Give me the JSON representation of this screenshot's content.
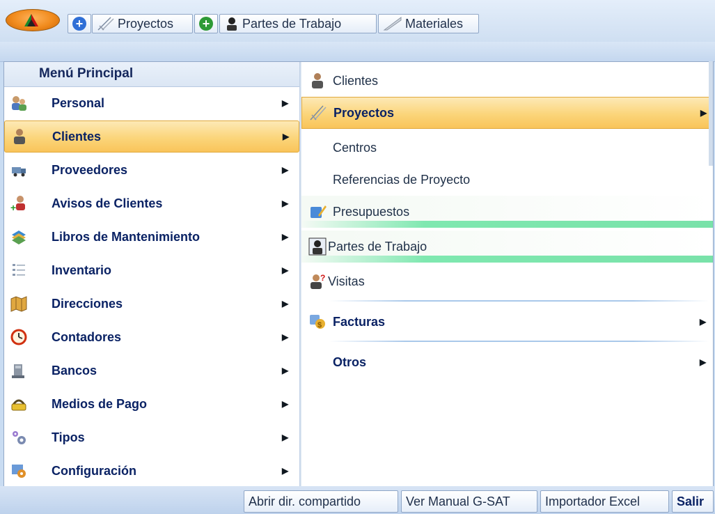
{
  "quick_access": {
    "items": [
      {
        "label": "Proyectos"
      },
      {
        "label": "Partes de Trabajo"
      },
      {
        "label": "Materiales"
      }
    ]
  },
  "menu": {
    "header": "Menú Principal",
    "left_items": [
      {
        "label": "Personal",
        "icon": "users-icon"
      },
      {
        "label": "Clientes",
        "icon": "client-icon"
      },
      {
        "label": "Proveedores",
        "icon": "truck-icon"
      },
      {
        "label": "Avisos de Clientes",
        "icon": "client-alert-icon"
      },
      {
        "label": "Libros de Mantenimiento",
        "icon": "books-icon"
      },
      {
        "label": "Inventario",
        "icon": "list-icon"
      },
      {
        "label": "Direcciones",
        "icon": "map-icon"
      },
      {
        "label": "Contadores",
        "icon": "clock-icon"
      },
      {
        "label": "Bancos",
        "icon": "bank-icon"
      },
      {
        "label": "Medios de Pago",
        "icon": "payment-icon"
      },
      {
        "label": "Tipos",
        "icon": "gears-icon"
      },
      {
        "label": "Configuración",
        "icon": "config-icon"
      }
    ],
    "right_items": [
      {
        "label": "Clientes",
        "icon": "client-icon"
      },
      {
        "label": "Proyectos",
        "icon": "project-icon"
      },
      {
        "label": "Centros"
      },
      {
        "label": "Referencias de Proyecto"
      },
      {
        "label": "Presupuestos",
        "icon": "budget-icon"
      },
      {
        "label": "Partes de Trabajo",
        "icon": "worker-icon"
      },
      {
        "label": "Visitas",
        "icon": "visit-icon"
      },
      {
        "label": "Facturas",
        "icon": "invoice-icon"
      },
      {
        "label": "Otros"
      }
    ]
  },
  "bottom": {
    "buttons": [
      {
        "label": "Abrir dir. compartido"
      },
      {
        "label": "Ver Manual G-SAT"
      },
      {
        "label": "Importador Excel"
      },
      {
        "label": "Salir"
      }
    ]
  }
}
